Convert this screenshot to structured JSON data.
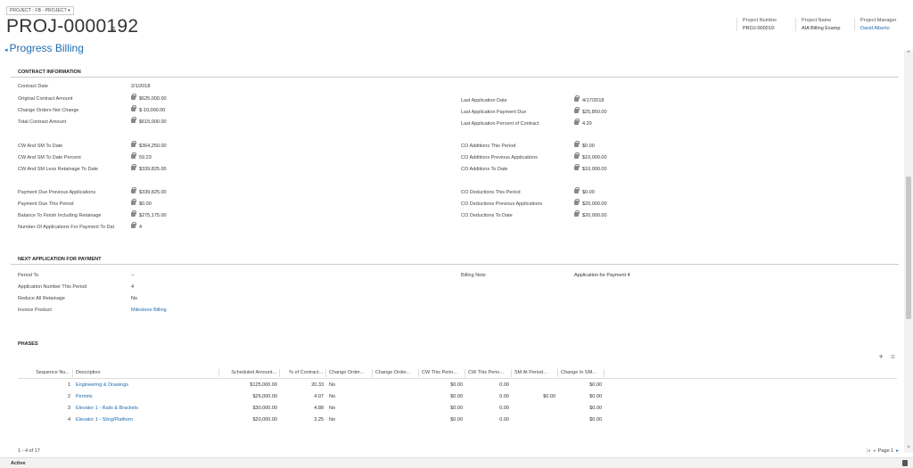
{
  "header": {
    "entity_selector": "PROJECT : FB - PROJECT ▾",
    "record_title": "PROJ-0000192",
    "menu_icon": "≡",
    "form_caret": "◂",
    "form_title": "Progress Billing",
    "fields": [
      {
        "label": "Project Number",
        "value": "PROJ-000019:"
      },
      {
        "label": "Project Name",
        "value": "AIA Billing Examp"
      },
      {
        "label": "Project Manager",
        "value": "David Alberto"
      }
    ]
  },
  "contract": {
    "section_title": "CONTRACT INFORMATION",
    "left": [
      {
        "label": "Contract Date",
        "value": "2/1/2018"
      },
      {
        "label": "Original Contract Amount",
        "value": "$625,000.00"
      },
      {
        "label": "Change Orders Net Change",
        "value": "$-10,000.00"
      },
      {
        "label": "Total Contract Amount",
        "value": "$615,000.00"
      },
      {
        "label": "CW And SM To Date",
        "value": "$364,250.00"
      },
      {
        "label": "CW And SM To Date Percent",
        "value": "59.23"
      },
      {
        "label": "CW And SM Less Retainage To Date",
        "value": "$339,825.00"
      },
      {
        "label": "Payment Due Previous Applications",
        "value": "$339,825.00"
      },
      {
        "label": "Payment Due This Period",
        "value": "$0.00"
      },
      {
        "label": "Balance To Finish Including Retainage",
        "value": "$275,175.00"
      },
      {
        "label": "Number Of Applications For Payment To Dat",
        "value": "4"
      }
    ],
    "right": [
      {
        "label": "Last Application Date",
        "value": "4/17/2018"
      },
      {
        "label": "Last Application Payment Due",
        "value": "$25,850.00"
      },
      {
        "label": "Last Application Percent of Contract",
        "value": "4.20"
      },
      {
        "label": "CO Additions This Period",
        "value": "$0.00"
      },
      {
        "label": "CO Additions Previous Applications",
        "value": "$10,000.00"
      },
      {
        "label": "CO Additions To Date",
        "value": "$10,000.00"
      },
      {
        "label": "CO Deductions This Period",
        "value": "$0.00"
      },
      {
        "label": "CO Deductions Previous Applications",
        "value": "$20,000.00"
      },
      {
        "label": "CO Deductions To Date",
        "value": "$20,000.00"
      }
    ]
  },
  "next_app": {
    "section_title": "NEXT APPLICATION FOR PAYMENT",
    "left": [
      {
        "label": "Period To",
        "value": "--"
      },
      {
        "label": "Application Number This Period",
        "value": "4"
      },
      {
        "label": "Reduce All Retainage",
        "value": "No"
      },
      {
        "label": "Invoice Product",
        "value": "Milestone Billing"
      }
    ],
    "billing_note_label": "Billing Note",
    "billing_note_value": "Application for Payment 4"
  },
  "phases": {
    "section_title": "PHASES",
    "add_icon": "+",
    "list_icon": "≡",
    "columns": [
      "Sequence Nu...",
      "Description",
      "Scheduled Amount...",
      "% of Contract...",
      "Change Order...",
      "Change Order...",
      "CW This Perio...",
      "CW This Perio...",
      "SM At Period...",
      "Change In SM..."
    ],
    "rows": [
      {
        "seq": "1",
        "desc": "Engineering & Drawings",
        "sched": "$125,000.00",
        "pct": "20.33",
        "co": "No",
        "cw1": "$0.00",
        "cw2": "0.00",
        "sm": "",
        "chg": "$0.00"
      },
      {
        "seq": "2",
        "desc": "Permits",
        "sched": "$25,000.00",
        "pct": "4.07",
        "co": "No",
        "cw1": "$0.00",
        "cw2": "0.00",
        "sm": "$0.00",
        "chg": "$0.00"
      },
      {
        "seq": "3",
        "desc": "Elevator 1 - Rails & Brackets",
        "sched": "$30,000.00",
        "pct": "4.88",
        "co": "No",
        "cw1": "$0.00",
        "cw2": "0.00",
        "sm": "",
        "chg": "$0.00"
      },
      {
        "seq": "4",
        "desc": "Elevator 1 - Sling/Platform",
        "sched": "$20,000.00",
        "pct": "3.25",
        "co": "No",
        "cw1": "$0.00",
        "cw2": "0.00",
        "sm": "",
        "chg": "$0.00"
      }
    ],
    "record_count": "1 - 4 of 17",
    "pager_first": "|◂",
    "pager_prev": "◂",
    "page_label": "Page 1",
    "pager_next": "▸"
  },
  "status": {
    "text": "Active"
  },
  "scroll": {
    "up": "⌃",
    "down": "⌄"
  }
}
